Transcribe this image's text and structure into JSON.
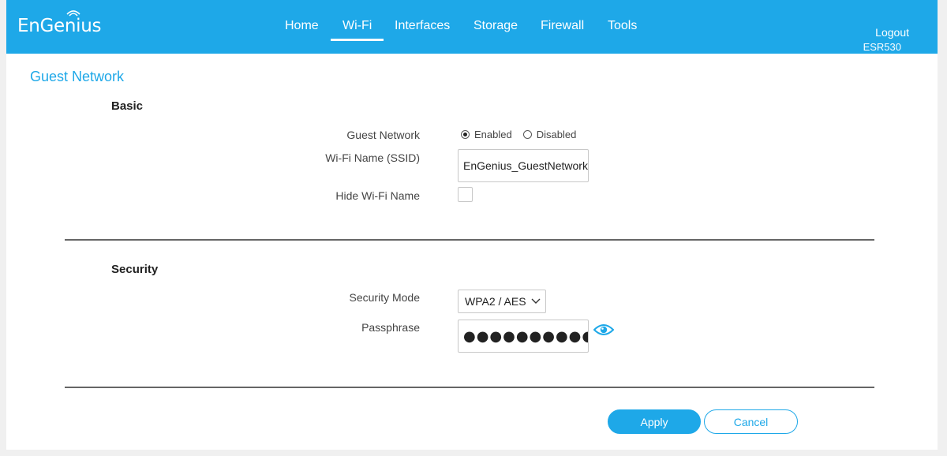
{
  "header": {
    "logo_text": "EnGenius",
    "nav": [
      {
        "label": "Home"
      },
      {
        "label": "Wi-Fi",
        "active": true
      },
      {
        "label": "Interfaces"
      },
      {
        "label": "Storage"
      },
      {
        "label": "Firewall"
      },
      {
        "label": "Tools"
      }
    ],
    "logout_label": "Logout",
    "model": "ESR530"
  },
  "page": {
    "title": "Guest Network"
  },
  "basic": {
    "section_title": "Basic",
    "guest_network_label": "Guest Network",
    "enabled_label": "Enabled",
    "disabled_label": "Disabled",
    "guest_network_value": "Enabled",
    "ssid_label": "Wi-Fi Name (SSID)",
    "ssid_value": "EnGenius_GuestNetwork",
    "hide_label": "Hide Wi-Fi Name",
    "hide_checked": false
  },
  "security": {
    "section_title": "Security",
    "mode_label": "Security Mode",
    "mode_value": "WPA2 / AES",
    "passphrase_label": "Passphrase",
    "passphrase_masked": "●●●●●●●●●●●●"
  },
  "actions": {
    "apply_label": "Apply",
    "cancel_label": "Cancel"
  },
  "colors": {
    "brand": "#1ea8e8",
    "background": "#ffffff",
    "divider": "#666666"
  },
  "icons": {
    "logo_wifi": "wifi-arc-icon",
    "dropdown": "chevron-down-icon",
    "reveal_password": "eye-icon"
  }
}
